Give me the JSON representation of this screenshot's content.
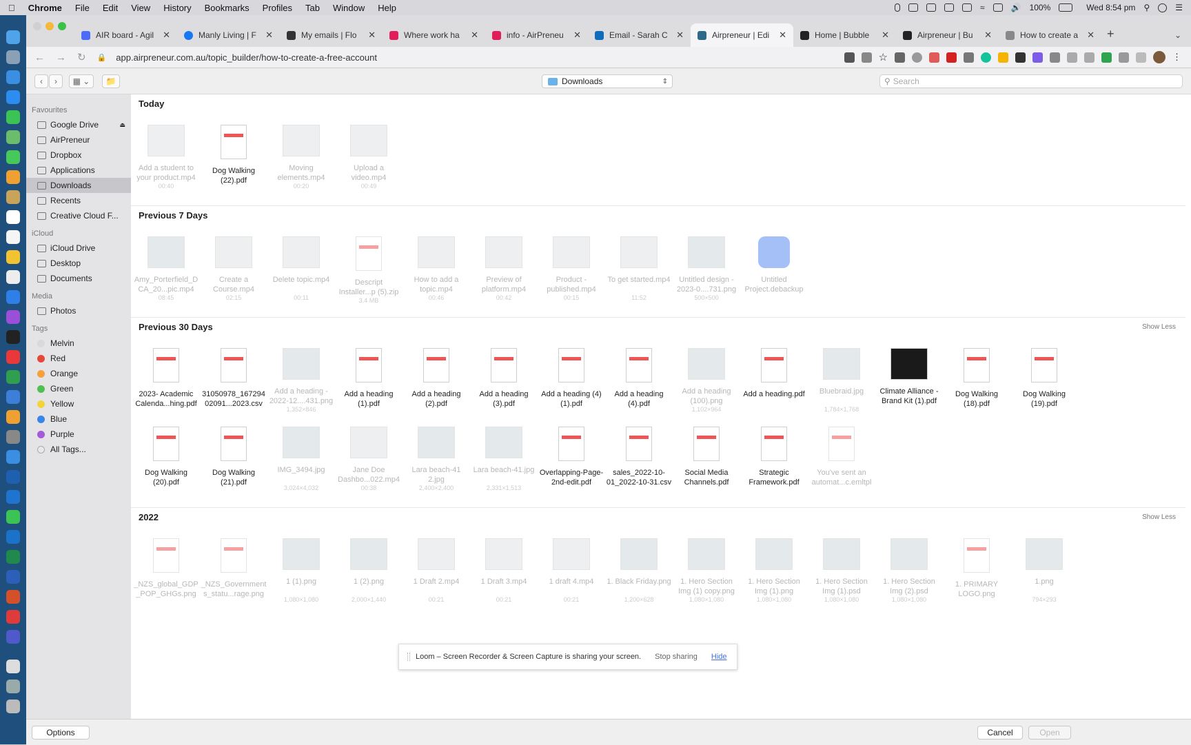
{
  "menubar": {
    "items": [
      "Chrome",
      "File",
      "Edit",
      "View",
      "History",
      "Bookmarks",
      "Profiles",
      "Tab",
      "Window",
      "Help"
    ],
    "battery": "100%",
    "clock": "Wed 8:54 pm"
  },
  "tabs": [
    {
      "title": "AIR board - Agil",
      "color": "#4a6cf7"
    },
    {
      "title": "Manly Living | F",
      "color": "#1877f2"
    },
    {
      "title": "My emails | Flo",
      "color": "#333333"
    },
    {
      "title": "Where work ha",
      "color": "#e01e5a"
    },
    {
      "title": "info - AirPreneu",
      "color": "#e01e5a"
    },
    {
      "title": "Email - Sarah C",
      "color": "#0f6cbd"
    },
    {
      "title": "Airpreneur | Edi",
      "color": "#2d6a8a",
      "active": true
    },
    {
      "title": "Home | Bubble",
      "color": "#222222"
    },
    {
      "title": "Airpreneur | Bu",
      "color": "#222222"
    },
    {
      "title": "How to create a",
      "color": "#888888"
    }
  ],
  "address": {
    "url": "app.airpreneur.com.au/topic_builder/how-to-create-a-free-account"
  },
  "dialog": {
    "location": "Downloads",
    "search_placeholder": "Search",
    "options_label": "Options",
    "cancel_label": "Cancel",
    "open_label": "Open"
  },
  "sidebar": {
    "favourites_header": "Favourites",
    "favourites": [
      "Google Drive",
      "AirPreneur",
      "Dropbox",
      "Applications",
      "Downloads",
      "Recents",
      "Creative Cloud F..."
    ],
    "icloud_header": "iCloud",
    "icloud": [
      "iCloud Drive",
      "Desktop",
      "Documents"
    ],
    "media_header": "Media",
    "media": [
      "Photos"
    ],
    "tags_header": "Tags",
    "tags": [
      {
        "name": "Melvin",
        "color": "#d9d9d9"
      },
      {
        "name": "Red",
        "color": "#e5483a"
      },
      {
        "name": "Orange",
        "color": "#f5a03a"
      },
      {
        "name": "Green",
        "color": "#4fbf53"
      },
      {
        "name": "Yellow",
        "color": "#f3d33a"
      },
      {
        "name": "Blue",
        "color": "#3a86e8"
      },
      {
        "name": "Purple",
        "color": "#a45ad9"
      },
      {
        "name": "All Tags...",
        "color": "#e9e9e9"
      }
    ]
  },
  "sections": {
    "today": {
      "title": "Today",
      "items": [
        {
          "name": "Add a student to your product.mp4",
          "meta": "00:40",
          "kind": "vid",
          "dim": true
        },
        {
          "name": "Dog Walking (22).pdf",
          "meta": "",
          "kind": "doc",
          "dim": false
        },
        {
          "name": "Moving elements.mp4",
          "meta": "00:20",
          "kind": "vid",
          "dim": true
        },
        {
          "name": "Upload a video.mp4",
          "meta": "00:49",
          "kind": "vid",
          "dim": true
        }
      ]
    },
    "prev7": {
      "title": "Previous 7 Days",
      "items": [
        {
          "name": "Amy_Porterfield_DCA_20...pic.mp4",
          "meta": "08:45",
          "kind": "img",
          "dim": true
        },
        {
          "name": "Create a Course.mp4",
          "meta": "02:15",
          "kind": "vid",
          "dim": true
        },
        {
          "name": "Delete topic.mp4",
          "meta": "00:11",
          "kind": "vid",
          "dim": true
        },
        {
          "name": "Descript Installer...p (5).zip",
          "meta": "3.4 MB",
          "kind": "doc",
          "dim": true
        },
        {
          "name": "How to add a topic.mp4",
          "meta": "00:46",
          "kind": "vid",
          "dim": true
        },
        {
          "name": "Preview of platform.mp4",
          "meta": "00:42",
          "kind": "vid",
          "dim": true
        },
        {
          "name": "Product - published.mp4",
          "meta": "00:15",
          "kind": "vid",
          "dim": true
        },
        {
          "name": "To get started.mp4",
          "meta": "11:52",
          "kind": "vid",
          "dim": true
        },
        {
          "name": "Untitled design - 2023-0....731.png",
          "meta": "500×500",
          "kind": "img",
          "dim": true
        },
        {
          "name": "Untitled Project.debackup",
          "meta": "",
          "kind": "app",
          "dim": true
        }
      ]
    },
    "prev30": {
      "title": "Previous 30 Days",
      "show_less": "Show Less",
      "items": [
        {
          "name": "2023- Academic Calenda...hing.pdf",
          "meta": "",
          "kind": "doc",
          "dim": false
        },
        {
          "name": "31050978_16729402091...2023.csv",
          "meta": "",
          "kind": "doc",
          "dim": false
        },
        {
          "name": "Add a heading - 2022-12....431.png",
          "meta": "1,352×846",
          "kind": "img",
          "dim": true
        },
        {
          "name": "Add a heading (1).pdf",
          "meta": "",
          "kind": "doc",
          "dim": false
        },
        {
          "name": "Add a heading (2).pdf",
          "meta": "",
          "kind": "doc",
          "dim": false
        },
        {
          "name": "Add a heading (3).pdf",
          "meta": "",
          "kind": "doc",
          "dim": false
        },
        {
          "name": "Add a heading (4) (1).pdf",
          "meta": "",
          "kind": "doc",
          "dim": false
        },
        {
          "name": "Add a heading (4).pdf",
          "meta": "",
          "kind": "doc",
          "dim": false
        },
        {
          "name": "Add a heading (100).png",
          "meta": "1,102×964",
          "kind": "img",
          "dim": true
        },
        {
          "name": "Add a heading.pdf",
          "meta": "",
          "kind": "doc",
          "dim": false
        },
        {
          "name": "Bluebraid.jpg",
          "meta": "1,784×1,768",
          "kind": "img",
          "dim": true
        },
        {
          "name": "Climate Alliance - Brand Kit (1).pdf",
          "meta": "",
          "kind": "dark",
          "dim": false
        },
        {
          "name": "Dog Walking (18).pdf",
          "meta": "",
          "kind": "doc",
          "dim": false
        },
        {
          "name": "Dog Walking (19).pdf",
          "meta": "",
          "kind": "doc",
          "dim": false
        },
        {
          "name": "Dog Walking (20).pdf",
          "meta": "",
          "kind": "doc",
          "dim": false
        },
        {
          "name": "Dog Walking (21).pdf",
          "meta": "",
          "kind": "doc",
          "dim": false
        },
        {
          "name": "IMG_3494.jpg",
          "meta": "3,024×4,032",
          "kind": "img",
          "dim": true
        },
        {
          "name": "Jane Doe Dashbo...022.mp4",
          "meta": "00:38",
          "kind": "vid",
          "dim": true
        },
        {
          "name": "Lara beach-41 2.jpg",
          "meta": "2,400×2,400",
          "kind": "img",
          "dim": true
        },
        {
          "name": "Lara beach-41.jpg",
          "meta": "2,331×1,513",
          "kind": "img",
          "dim": true
        },
        {
          "name": "Overlapping-Page-2nd-edit.pdf",
          "meta": "",
          "kind": "doc",
          "dim": false
        },
        {
          "name": "sales_2022-10-01_2022-10-31.csv",
          "meta": "",
          "kind": "doc",
          "dim": false
        },
        {
          "name": "Social Media Channels.pdf",
          "meta": "",
          "kind": "doc",
          "dim": false
        },
        {
          "name": "Strategic Framework.pdf",
          "meta": "",
          "kind": "doc",
          "dim": false
        },
        {
          "name": "You've sent an automat...c.emltpl",
          "meta": "",
          "kind": "doc",
          "dim": true
        }
      ]
    },
    "y2022": {
      "title": "2022",
      "show_less": "Show Less",
      "items": [
        {
          "name": "_NZS_global_GDP_POP_GHGs.png",
          "meta": "",
          "kind": "doc",
          "dim": true
        },
        {
          "name": "_NZS_Governments_statu...rage.png",
          "meta": "",
          "kind": "doc",
          "dim": true
        },
        {
          "name": "1 (1).png",
          "meta": "1,080×1,080",
          "kind": "img",
          "dim": true
        },
        {
          "name": "1 (2).png",
          "meta": "2,000×1,440",
          "kind": "img",
          "dim": true
        },
        {
          "name": "1 Draft 2.mp4",
          "meta": "00:21",
          "kind": "vid",
          "dim": true
        },
        {
          "name": "1 Draft 3.mp4",
          "meta": "00:21",
          "kind": "vid",
          "dim": true
        },
        {
          "name": "1 draft 4.mp4",
          "meta": "00:21",
          "kind": "vid",
          "dim": true
        },
        {
          "name": "1. Black Friday.png",
          "meta": "1,200×628",
          "kind": "img",
          "dim": true
        },
        {
          "name": "1. Hero Section Img (1) copy.png",
          "meta": "1,080×1,080",
          "kind": "img",
          "dim": true
        },
        {
          "name": "1. Hero Section Img (1).png",
          "meta": "1,080×1,080",
          "kind": "img",
          "dim": true
        },
        {
          "name": "1. Hero Section Img (1).psd",
          "meta": "1,080×1,080",
          "kind": "img",
          "dim": true
        },
        {
          "name": "1. Hero Section Img (2).psd",
          "meta": "1,080×1,080",
          "kind": "img",
          "dim": true
        },
        {
          "name": "1. PRIMARY LOGO.png",
          "meta": "",
          "kind": "doc",
          "dim": true
        },
        {
          "name": "1.png",
          "meta": "794×293",
          "kind": "img",
          "dim": true
        }
      ]
    }
  },
  "loom": {
    "message": "Loom – Screen Recorder & Screen Capture is sharing your screen.",
    "stop_label": "Stop sharing",
    "hide_label": "Hide"
  }
}
